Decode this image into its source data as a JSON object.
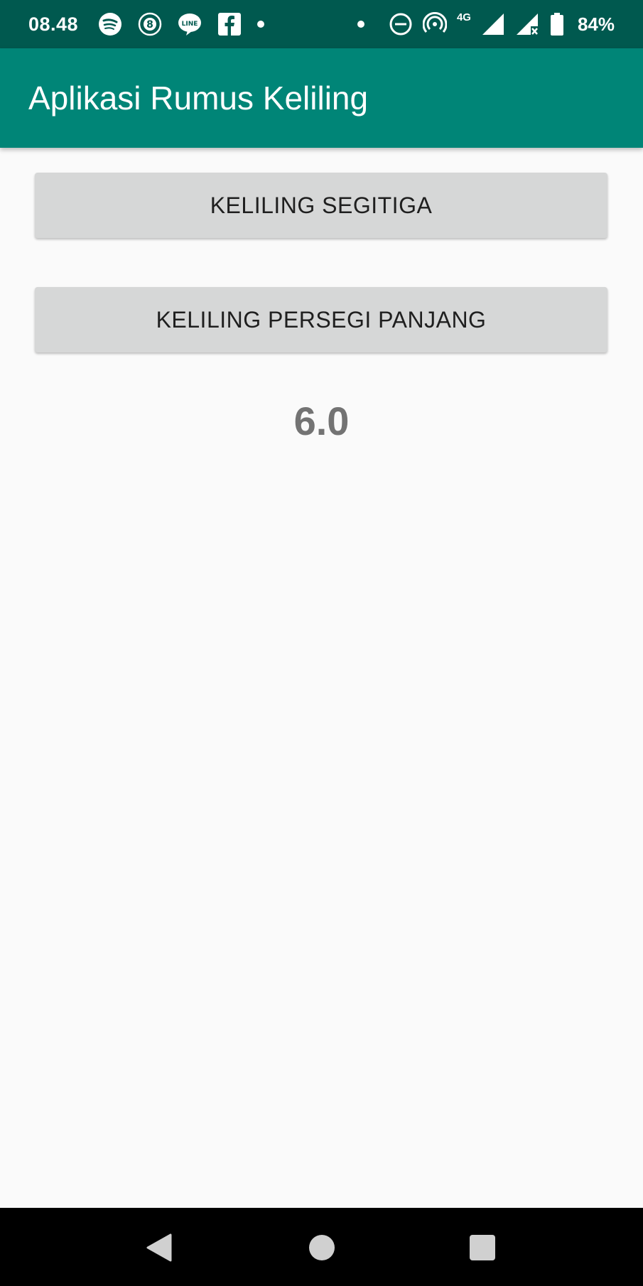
{
  "status_bar": {
    "time": "08.48",
    "notification_icons": [
      "spotify-icon",
      "eight-icon",
      "line-icon",
      "facebook-icon",
      "dot-icon"
    ],
    "network_label": "4G",
    "battery_percent": "84%"
  },
  "app_bar": {
    "title": "Aplikasi Rumus Keliling"
  },
  "buttons": {
    "triangle": "KELILING SEGITIGA",
    "rectangle": "KELILING PERSEGI PANJANG"
  },
  "result": {
    "value": "6.0"
  },
  "colors": {
    "status_bar": "#00594f",
    "app_bar": "#008577",
    "button": "#d6d7d7",
    "result_text": "#737373",
    "background": "#fafafa"
  }
}
